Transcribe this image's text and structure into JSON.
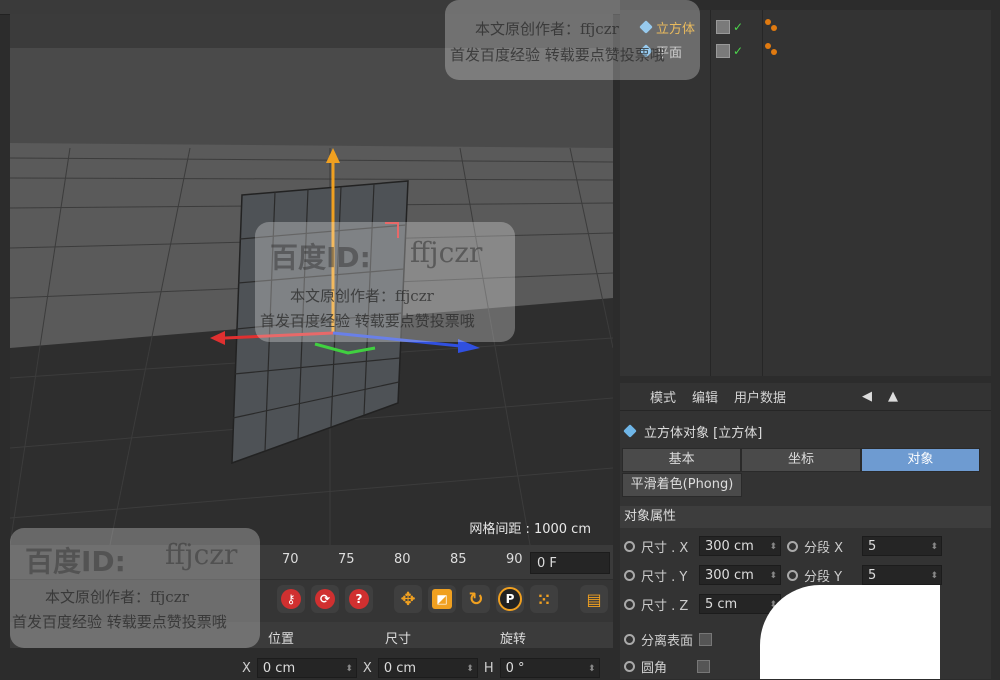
{
  "object_manager": {
    "objects": [
      {
        "name": "立方体",
        "active": true
      },
      {
        "name": "平面",
        "active": false
      }
    ]
  },
  "viewport": {
    "grid_spacing_label": "网格间距 : 1000 cm"
  },
  "attributes": {
    "menu": [
      "模式",
      "编辑",
      "用户数据"
    ],
    "title": "立方体对象 [立方体]",
    "tabs": [
      {
        "label": "基本",
        "active": false
      },
      {
        "label": "坐标",
        "active": false
      },
      {
        "label": "对象",
        "active": true
      }
    ],
    "phong_tab": "平滑着色(Phong)",
    "section": "对象属性",
    "props": [
      {
        "label": "尺寸 . X",
        "value": "300 cm",
        "seg_label": "分段 X",
        "seg_value": "5"
      },
      {
        "label": "尺寸 . Y",
        "value": "300 cm",
        "seg_label": "分段 Y",
        "seg_value": "5"
      },
      {
        "label": "尺寸 . Z",
        "value": "5 cm"
      }
    ],
    "separate_surfaces": "分离表面",
    "fillet": "圆角"
  },
  "timeline": {
    "ticks": [
      "70",
      "75",
      "80",
      "85",
      "90"
    ],
    "current_frame": "0 F"
  },
  "coordinates": {
    "headers": [
      "位置",
      "尺寸",
      "旋转"
    ],
    "x_label": "X",
    "x_pos": "0 cm",
    "x_size": "0 cm",
    "h_label": "H",
    "h_value": "0 °"
  },
  "watermark": {
    "brand": "百度ID:",
    "id": "ffjczr",
    "line1": "本文原创作者：ffjczr",
    "line2": "首发百度经验 转载要点赞投票哦"
  },
  "colors": {
    "accent_tab": "#6e9bd1",
    "object_active": "#e0a020",
    "axis_y": "#f0a020",
    "axis_x": "#e03030",
    "axis_z": "#3050e0",
    "axis_green": "#40d040"
  }
}
